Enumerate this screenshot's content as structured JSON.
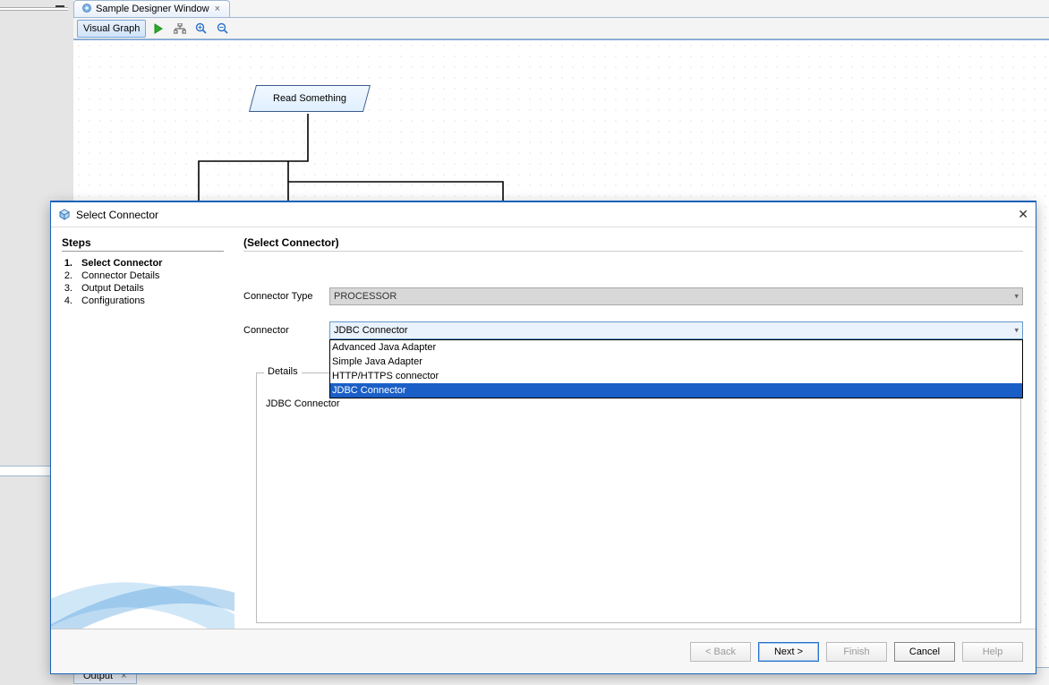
{
  "tab": {
    "title": "Sample Designer Window"
  },
  "toolbar": {
    "mode": "Visual Graph"
  },
  "node": {
    "label": "Read Something"
  },
  "bottomTab": {
    "label": "Output"
  },
  "dialog": {
    "title": "Select Connector",
    "contentHeading": "(Select Connector)",
    "stepsHeading": "Steps",
    "steps": [
      {
        "n": "1.",
        "label": "Select Connector"
      },
      {
        "n": "2.",
        "label": "Connector Details"
      },
      {
        "n": "3.",
        "label": "Output Details"
      },
      {
        "n": "4.",
        "label": "Configurations"
      }
    ],
    "fields": {
      "connectorTypeLabel": "Connector Type",
      "connectorTypeValue": "PROCESSOR",
      "connectorLabel": "Connector",
      "connectorValue": "JDBC Connector",
      "detailsLabel": "Details",
      "detailsValue": "JDBC Connector"
    },
    "options": [
      "Advanced Java Adapter",
      "Simple Java Adapter",
      "HTTP/HTTPS connector",
      "JDBC Connector"
    ],
    "buttons": {
      "back": "< Back",
      "next": "Next >",
      "finish": "Finish",
      "cancel": "Cancel",
      "help": "Help"
    }
  }
}
